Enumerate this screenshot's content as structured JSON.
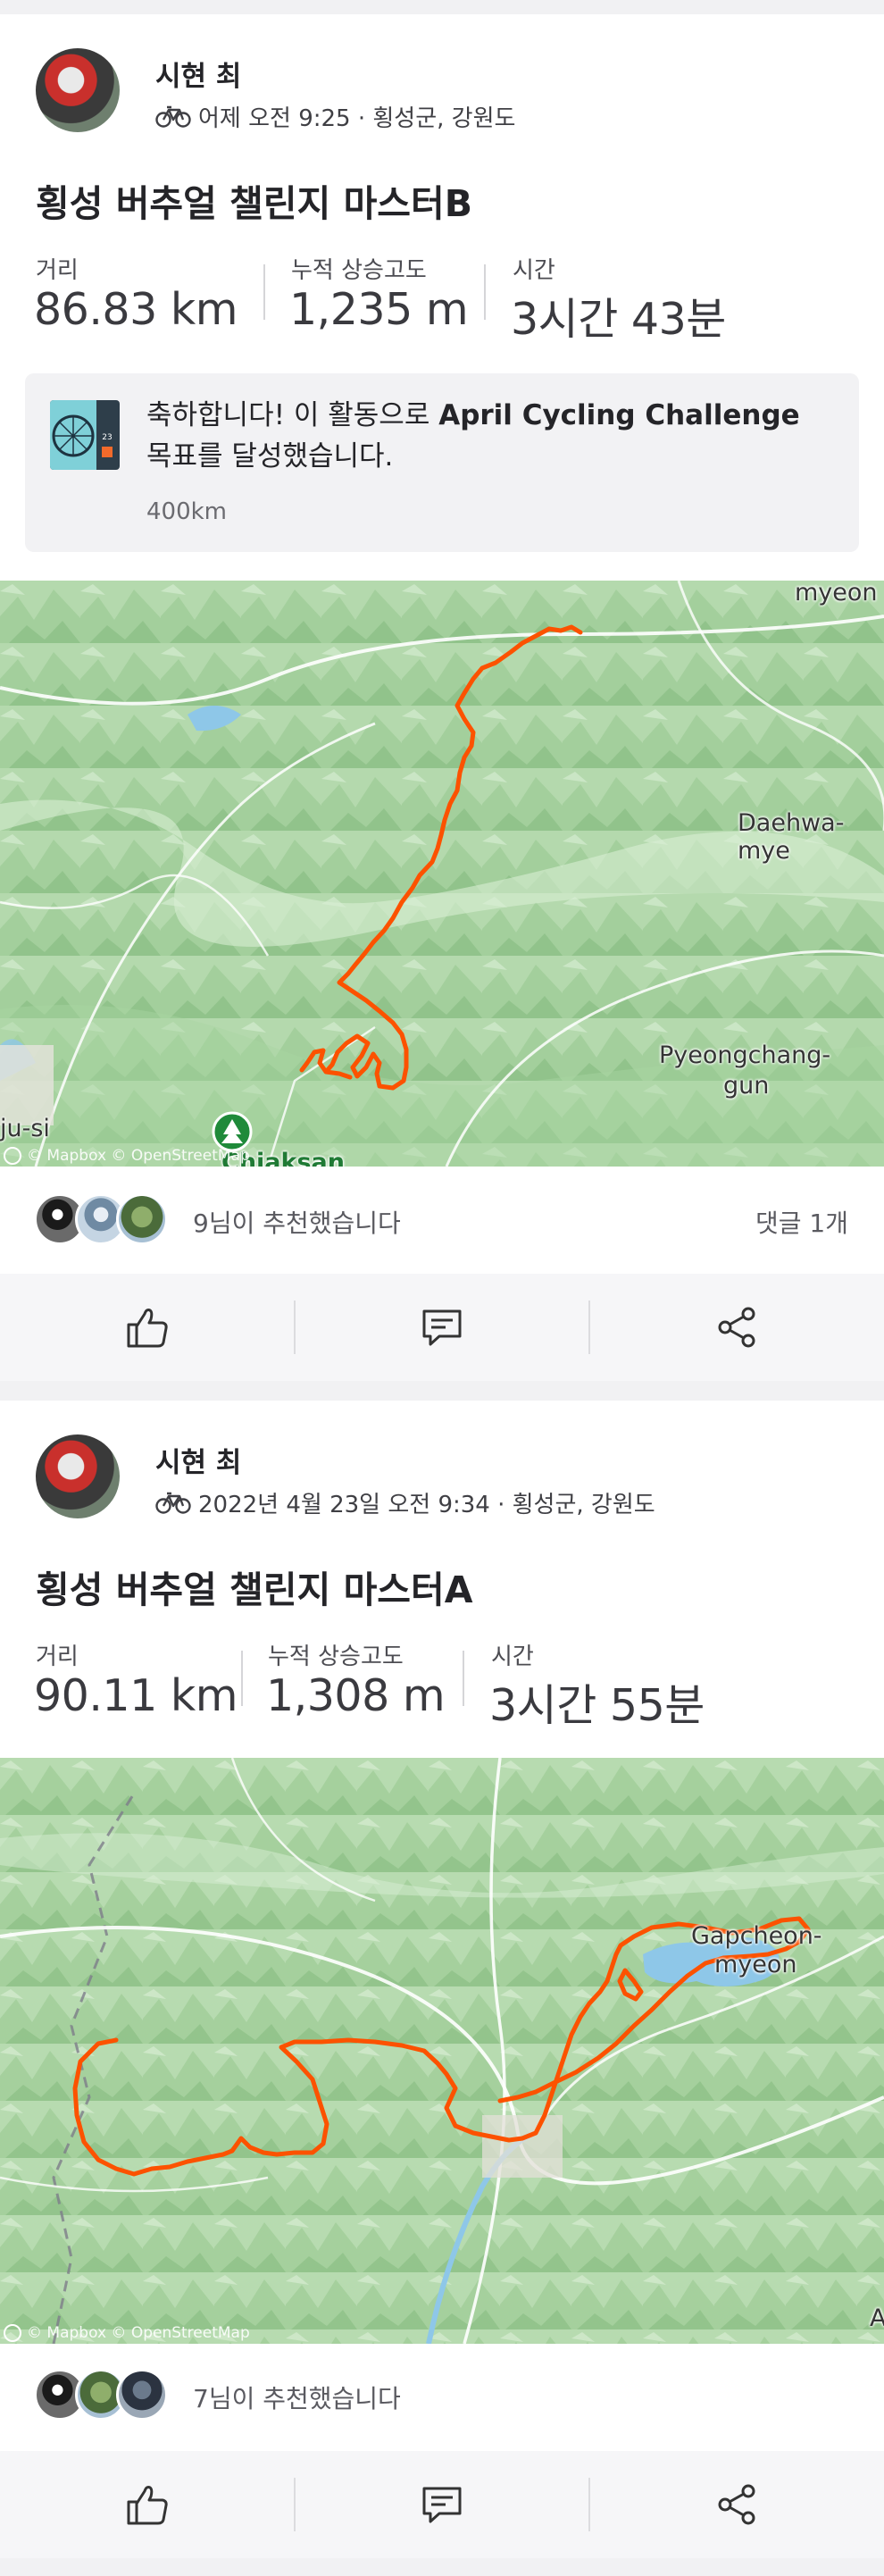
{
  "activities": [
    {
      "athlete": "시현 최",
      "meta_text": "어제 오전 9:25 · 횡성군, 강원도",
      "title": "횡성 버추얼 챌린지 마스터B",
      "stats": [
        {
          "label": "거리",
          "value": "86.83 km"
        },
        {
          "label": "누적 상승고도",
          "value": "1,235 m"
        },
        {
          "label": "시간",
          "value": "3시간 43분"
        }
      ],
      "achievement": {
        "text_prefix": "축하합니다! 이 활동으로 ",
        "challenge": "April Cycling Challenge",
        "text_suffix": " 목표를 달성했습니다.",
        "sub": "400km"
      },
      "map_labels": [
        "myeon",
        "Daehwa-mye",
        "Pyeongchang-",
        "gun",
        "ju-si",
        "Chiaksan"
      ],
      "map_attribution": "© Mapbox © OpenStreetMap",
      "kudos_text": "9님이 추천했습니다",
      "comment_text": "댓글 1개"
    },
    {
      "athlete": "시현 최",
      "meta_text": "2022년 4월 23일 오전 9:34 · 횡성군, 강원도",
      "title": "횡성 버추얼 챌린지 마스터A",
      "stats": [
        {
          "label": "거리",
          "value": "90.11 km"
        },
        {
          "label": "누적 상승고도",
          "value": "1,308 m"
        },
        {
          "label": "시간",
          "value": "3시간 55분"
        }
      ],
      "map_labels": [
        "Gapcheon-",
        "myeon",
        "A"
      ],
      "map_attribution": "© Mapbox © OpenStreetMap",
      "kudos_text": "7님이 추천했습니다"
    }
  ],
  "icons": {
    "activity_type": "bike-icon",
    "kudos": "thumbs-up-icon",
    "comment": "comment-icon",
    "share": "share-icon",
    "map_pin": "tree-pin-icon"
  },
  "colors": {
    "route": "#fc5200",
    "map_green": "#b9dcb3",
    "text_primary": "#242428"
  }
}
